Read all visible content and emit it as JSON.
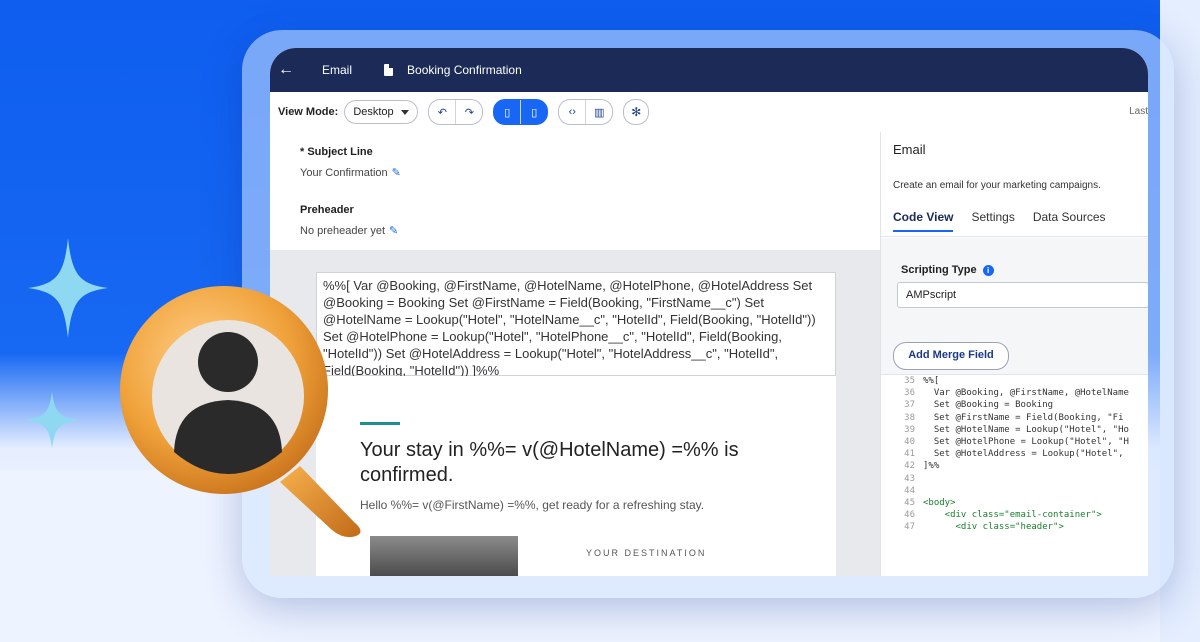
{
  "colors": {
    "nav_bg": "#1b2a57",
    "accent": "#1766f4",
    "teal": "#1e8f8a",
    "background": "#0f5ef0"
  },
  "topbar": {
    "back_icon": "arrow-left-icon",
    "crumb": "Email",
    "doc_icon": "document-icon",
    "doc_title": "Booking Confirmation"
  },
  "toolbar": {
    "view_mode_label": "View Mode:",
    "view_mode_value": "Desktop",
    "undo_icon": "undo-icon",
    "redo_icon": "redo-icon",
    "layout_icons": [
      "panel-left-icon",
      "panel-right-icon"
    ],
    "code_icon": "code-icon",
    "chart_icon": "chart-icon",
    "settings_icon": "gear-icon",
    "last_text": "Last"
  },
  "editor": {
    "subject_label": "* Subject Line",
    "subject_value": "Your Confirmation",
    "preheader_label": "Preheader",
    "preheader_value": "No preheader yet",
    "code_snippet": "%%[ Var @Booking, @FirstName, @HotelName, @HotelPhone, @HotelAddress Set @Booking = Booking Set @FirstName = Field(Booking, \"FirstName__c\") Set @HotelName = Lookup(\"Hotel\", \"HotelName__c\", \"HotelId\", Field(Booking, \"HotelId\")) Set @HotelPhone = Lookup(\"Hotel\", \"HotelPhone__c\", \"HotelId\", Field(Booking, \"HotelId\")) Set @HotelAddress = Lookup(\"Hotel\", \"HotelAddress__c\", \"HotelId\", Field(Booking, \"HotelId\")) ]%%",
    "headline": "Your stay in %%= v(@HotelName) =%% is confirmed.",
    "greeting": "Hello %%= v(@FirstName) =%%, get ready for a refreshing stay.",
    "destination_label": "YOUR DESTINATION"
  },
  "panel": {
    "title": "Email",
    "description": "Create an email for your marketing campaigns.",
    "tabs": [
      "Code View",
      "Settings",
      "Data Sources"
    ],
    "scripting_label": "Scripting Type",
    "scripting_value": "AMPscript",
    "merge_button": "Add Merge Field",
    "code_lines": [
      {
        "n": "35",
        "t": "%%["
      },
      {
        "n": "36",
        "t": "  Var @Booking, @FirstName, @HotelName"
      },
      {
        "n": "37",
        "t": "  Set @Booking = Booking"
      },
      {
        "n": "38",
        "t": "  Set @FirstName = Field(Booking, \"Fi"
      },
      {
        "n": "39",
        "t": "  Set @HotelName = Lookup(\"Hotel\", \"Ho"
      },
      {
        "n": "40",
        "t": "  Set @HotelPhone = Lookup(\"Hotel\", \"H"
      },
      {
        "n": "41",
        "t": "  Set @HotelAddress = Lookup(\"Hotel\","
      },
      {
        "n": "42",
        "t": "]%%"
      },
      {
        "n": "43",
        "t": ""
      },
      {
        "n": "44",
        "t": ""
      },
      {
        "n": "45",
        "t": "<body>"
      },
      {
        "n": "46",
        "t": "    <div class=\"email-container\">"
      },
      {
        "n": "47",
        "t": "      <div class=\"header\">"
      }
    ]
  }
}
